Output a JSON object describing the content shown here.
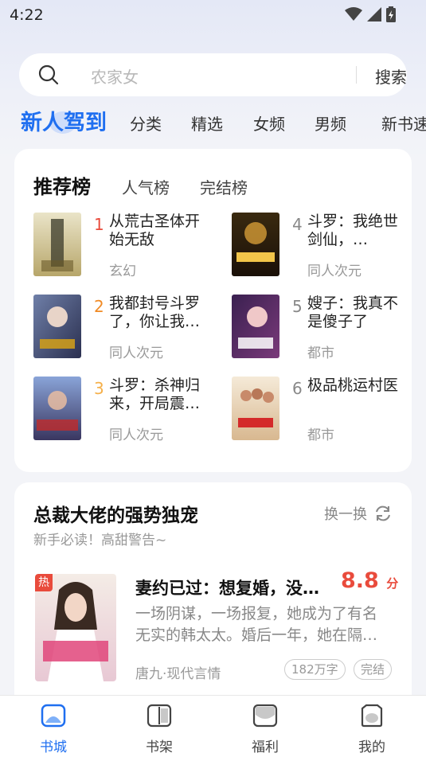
{
  "status": {
    "time": "4:22"
  },
  "search": {
    "placeholder": "农家女",
    "button": "搜索"
  },
  "tabs": [
    {
      "label": "新人驾到",
      "active": true
    },
    {
      "label": "分类"
    },
    {
      "label": "精选"
    },
    {
      "label": "女频"
    },
    {
      "label": "男频"
    },
    {
      "label": "新书速"
    }
  ],
  "ranking": {
    "title": "推荐榜",
    "tabs": [
      "人气榜",
      "完结榜"
    ],
    "books": [
      {
        "rank": "1",
        "title": "从荒古圣体开始无敌",
        "genre": "玄幻",
        "rank_color": "#e94b3c"
      },
      {
        "rank": "2",
        "title": "我都封号斗罗了，你让我…",
        "genre": "同人次元",
        "rank_color": "#f08a24"
      },
      {
        "rank": "3",
        "title": "斗罗：杀神归来，开局震…",
        "genre": "同人次元",
        "rank_color": "#f5b04a"
      },
      {
        "rank": "4",
        "title": "斗罗：我绝世剑仙，…",
        "genre": "同人次元",
        "rank_color": "#888888"
      },
      {
        "rank": "5",
        "title": "嫂子：我真不是傻子了",
        "genre": "都市",
        "rank_color": "#888888"
      },
      {
        "rank": "6",
        "title": "极品桃运村医",
        "genre": "都市",
        "rank_color": "#888888"
      }
    ]
  },
  "section": {
    "title": "总裁大佬的强势独宠",
    "subtitle": "新手必读！高甜警告~",
    "swap_label": "换一换",
    "book": {
      "badge": "热",
      "title": "妻约已过：想复婚，没门！",
      "score": "8.8",
      "score_unit": "分",
      "desc": "一场阴谋，一场报复，她成为了有名无实的韩太太。婚后一年，她在隔…",
      "meta": "唐九·现代言情",
      "words": "182万字",
      "status": "完结"
    }
  },
  "nav": [
    {
      "label": "书城",
      "icon": "bookstore-icon",
      "active": true
    },
    {
      "label": "书架",
      "icon": "bookshelf-icon"
    },
    {
      "label": "福利",
      "icon": "welfare-icon"
    },
    {
      "label": "我的",
      "icon": "profile-icon"
    }
  ],
  "colors": {
    "accent": "#1f6ff0",
    "hot": "#e94b3c"
  }
}
